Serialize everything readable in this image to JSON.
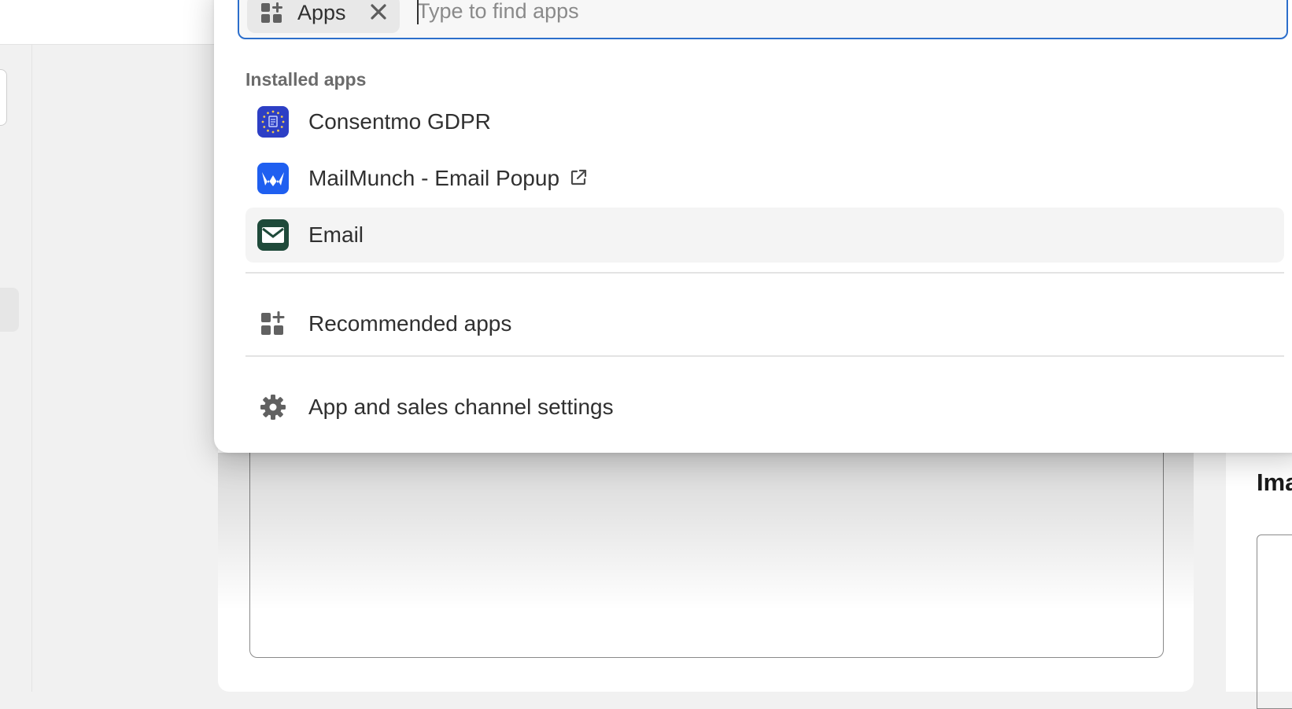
{
  "search": {
    "chip_label": "Apps",
    "placeholder": "Type to find apps",
    "value": ""
  },
  "installed": {
    "title": "Installed apps",
    "items": [
      {
        "label": "Consentmo GDPR",
        "icon": "consentmo-gdpr-icon",
        "color": "#2d3fc5"
      },
      {
        "label": "MailMunch - Email Popup",
        "icon": "mailmunch-icon",
        "color": "#1f5ff0",
        "external": true
      },
      {
        "label": "Email",
        "icon": "email-icon",
        "color": "#1f4a3a"
      }
    ]
  },
  "menu": {
    "recommended_label": "Recommended apps",
    "settings_label": "App and sales channel settings"
  },
  "background": {
    "side_heading": "Ima"
  },
  "colors": {
    "focus_border": "#2c6ecb",
    "hover_bg": "#f4f4f4"
  }
}
